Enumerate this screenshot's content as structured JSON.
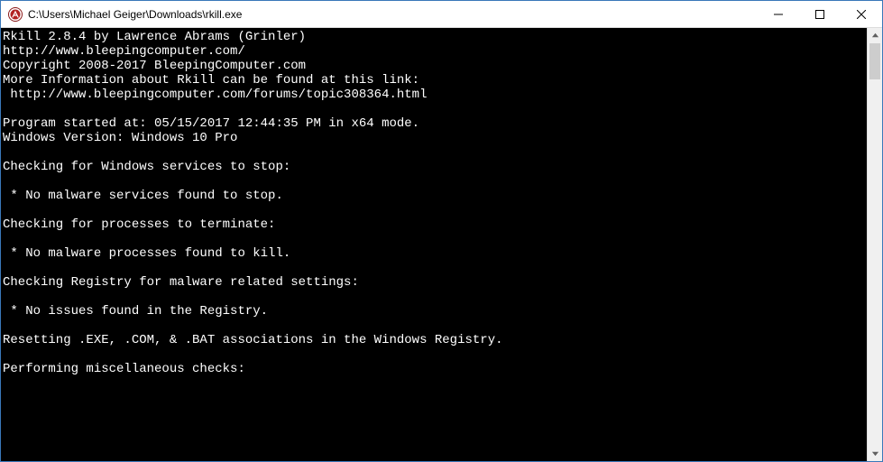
{
  "window": {
    "title": "C:\\Users\\Michael Geiger\\Downloads\\rkill.exe"
  },
  "console": {
    "lines": [
      "Rkill 2.8.4 by Lawrence Abrams (Grinler)",
      "http://www.bleepingcomputer.com/",
      "Copyright 2008-2017 BleepingComputer.com",
      "More Information about Rkill can be found at this link:",
      " http://www.bleepingcomputer.com/forums/topic308364.html",
      "",
      "Program started at: 05/15/2017 12:44:35 PM in x64 mode.",
      "Windows Version: Windows 10 Pro",
      "",
      "Checking for Windows services to stop:",
      "",
      " * No malware services found to stop.",
      "",
      "Checking for processes to terminate:",
      "",
      " * No malware processes found to kill.",
      "",
      "Checking Registry for malware related settings:",
      "",
      " * No issues found in the Registry.",
      "",
      "Resetting .EXE, .COM, & .BAT associations in the Windows Registry.",
      "",
      "Performing miscellaneous checks:"
    ]
  }
}
